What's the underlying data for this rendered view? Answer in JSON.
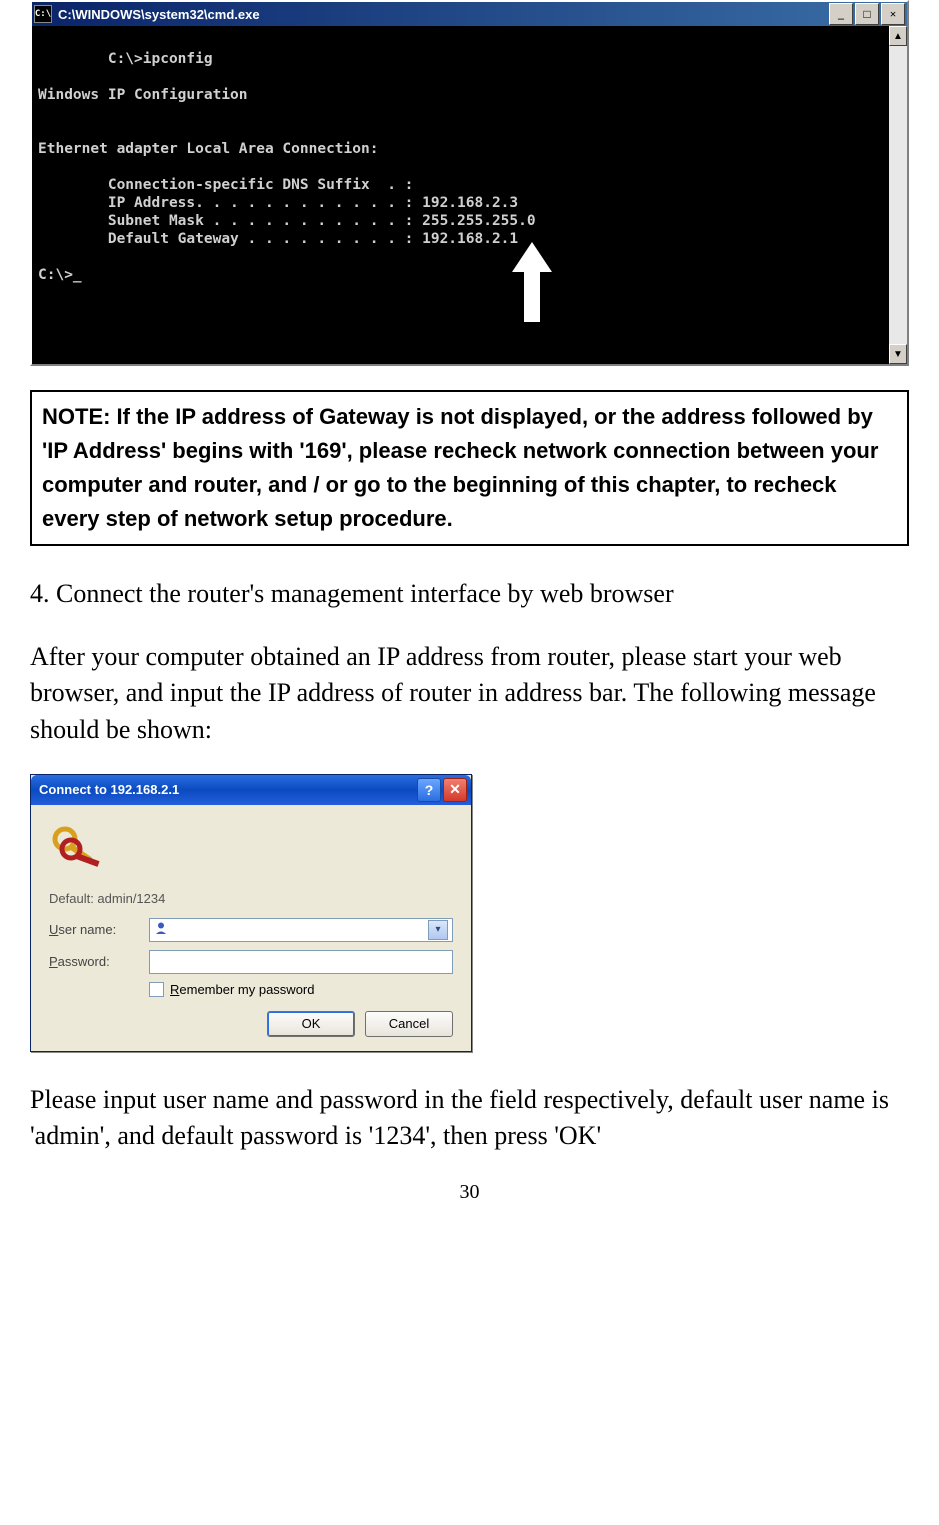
{
  "cmd": {
    "title": "C:\\WINDOWS\\system32\\cmd.exe",
    "icon_label": "C:\\",
    "console": "C:\\>ipconfig\n\nWindows IP Configuration\n\n\nEthernet adapter Local Area Connection:\n\n        Connection-specific DNS Suffix  . :\n        IP Address. . . . . . . . . . . . : 192.168.2.3\n        Subnet Mask . . . . . . . . . . . : 255.255.255.0\n        Default Gateway . . . . . . . . . : 192.168.2.1\n\nC:\\>_"
  },
  "note": "NOTE: If the IP address of Gateway is not displayed, or the address followed by 'IP Address' begins with '169', please recheck network connection between your computer and router, and / or go to the beginning of this chapter, to recheck every step of network setup procedure.",
  "step_title": "4. Connect the router's management interface by web browser",
  "step_body": "After your computer obtained an IP address from router, please start your web browser, and input the IP address of router in address bar. The following message should be shown:",
  "dialog": {
    "title": "Connect to 192.168.2.1",
    "realm": "Default: admin/1234",
    "user_label": "User name:",
    "pass_label": "Password:",
    "remember": "Remember my password",
    "ok": "OK",
    "cancel": "Cancel"
  },
  "after": "Please input user name and password in the field respectively, default user name is 'admin', and default password is '1234', then press 'OK'",
  "page_number": "30"
}
